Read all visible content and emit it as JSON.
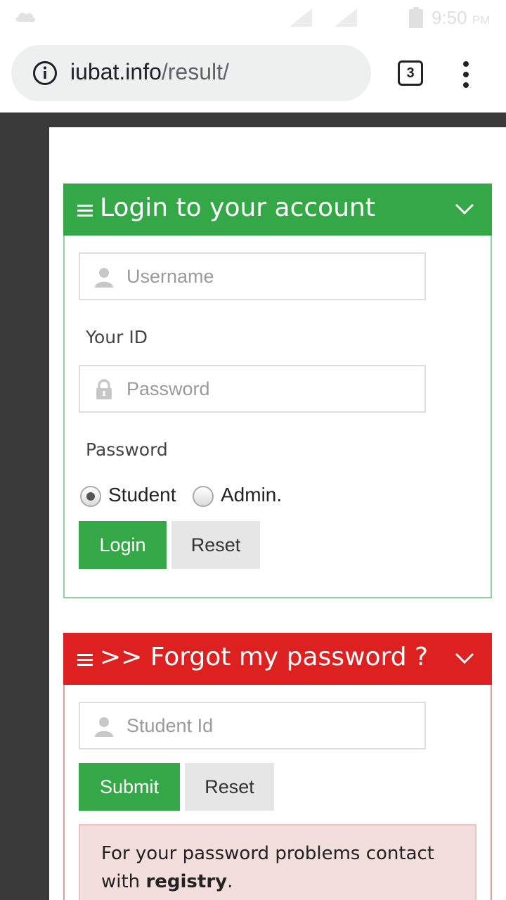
{
  "status_bar": {
    "time": "9:50",
    "ampm": "PM"
  },
  "browser": {
    "url_host": "iubat.info",
    "url_path": "/result/",
    "tab_count": "3"
  },
  "login_panel": {
    "title": "Login to your account",
    "username_placeholder": "Username",
    "username_help": "Your ID",
    "password_placeholder": "Password",
    "password_help": "Password",
    "radio_student": "Student",
    "radio_admin": "Admin.",
    "selected_role": "Student",
    "login_button": "Login",
    "reset_button": "Reset",
    "accent_color": "#34a847"
  },
  "forgot_panel": {
    "title": ">> Forgot my password ?",
    "student_id_placeholder": "Student Id",
    "submit_button": "Submit",
    "reset_button": "Reset",
    "notice_text": "For your password problems contact with",
    "notice_bold": "registry",
    "notice_end": ".",
    "accent_color": "#dd2020"
  },
  "icons": {
    "status": [
      "cloud-icon",
      "signal-icon",
      "battery-icon"
    ],
    "browser": [
      "info-icon",
      "tabs-icon",
      "more-menu-icon"
    ],
    "panel": [
      "hamburger-icon",
      "chevron-down-icon"
    ],
    "fields": [
      "user-icon",
      "lock-icon"
    ]
  }
}
